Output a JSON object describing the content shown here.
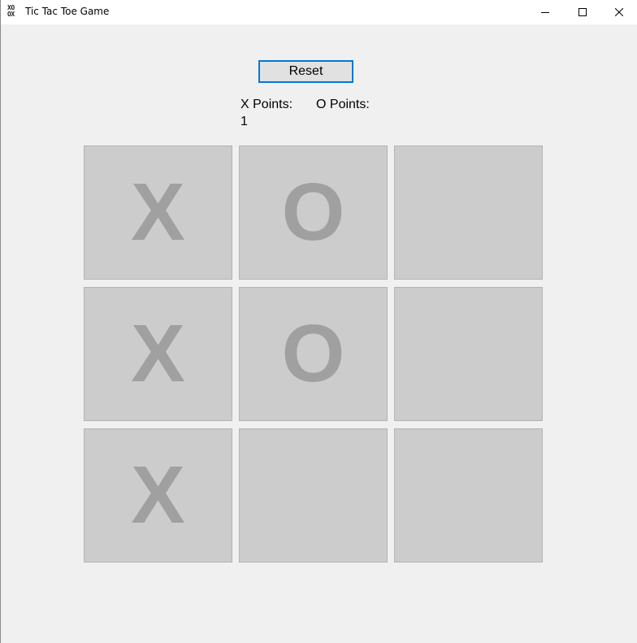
{
  "window": {
    "title": "Tic Tac Toe Game",
    "icon_glyphs": [
      "XO",
      "OX"
    ]
  },
  "controls": {
    "reset_label": "Reset"
  },
  "scores": {
    "x_label": "X Points:",
    "x_value": "1",
    "o_label": "O Points:",
    "o_value": ""
  },
  "board": {
    "cells": [
      [
        "X",
        "O",
        ""
      ],
      [
        "X",
        "O",
        ""
      ],
      [
        "X",
        "",
        ""
      ]
    ]
  },
  "colors": {
    "background": "#f0f0f0",
    "cell": "#cccccc",
    "mark": "#a0a0a0",
    "focus_border": "#0078d7"
  },
  "icons": [
    "app-tictactoe-icon",
    "minimize-icon",
    "maximize-icon",
    "close-icon"
  ]
}
